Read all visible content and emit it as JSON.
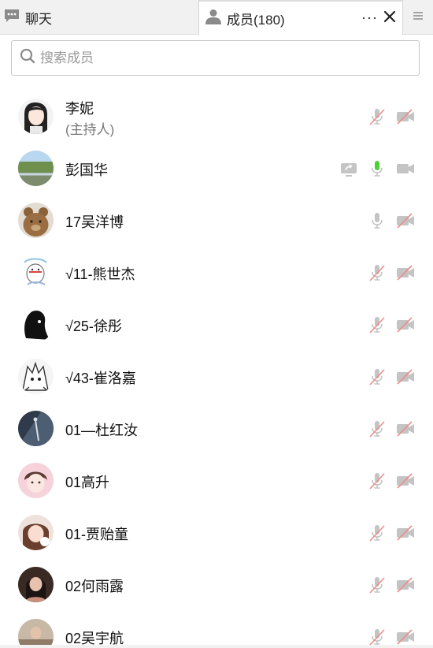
{
  "tabs": {
    "chat_label": "聊天",
    "members_label": "成员(180)",
    "more_label": "···"
  },
  "search": {
    "placeholder": "搜索成员"
  },
  "members": [
    {
      "name": "李妮",
      "role": "(主持人)",
      "mic": "muted",
      "camera": "off"
    },
    {
      "name": "彭国华",
      "role": "",
      "mic": "active",
      "camera": "off-gray",
      "sharing": true
    },
    {
      "name": "17吴洋博",
      "role": "",
      "mic": "idle",
      "camera": "off"
    },
    {
      "name": "√11-熊世杰",
      "role": "",
      "mic": "muted",
      "camera": "off"
    },
    {
      "name": "√25-徐彤",
      "role": "",
      "mic": "muted",
      "camera": "off"
    },
    {
      "name": "√43-崔洛嘉",
      "role": "",
      "mic": "muted",
      "camera": "off"
    },
    {
      "name": "01—杜红汝",
      "role": "",
      "mic": "muted",
      "camera": "off"
    },
    {
      "name": "01高升",
      "role": "",
      "mic": "muted",
      "camera": "off"
    },
    {
      "name": "01-贾贻童",
      "role": "",
      "mic": "muted",
      "camera": "off"
    },
    {
      "name": "02何雨露",
      "role": "",
      "mic": "muted",
      "camera": "off"
    },
    {
      "name": "02吴宇航",
      "role": "",
      "mic": "muted",
      "camera": "off"
    }
  ],
  "colors": {
    "active_mic": "#4cd137",
    "muted_slash": "#f08a8a",
    "icon_gray": "#c4c4c4"
  }
}
